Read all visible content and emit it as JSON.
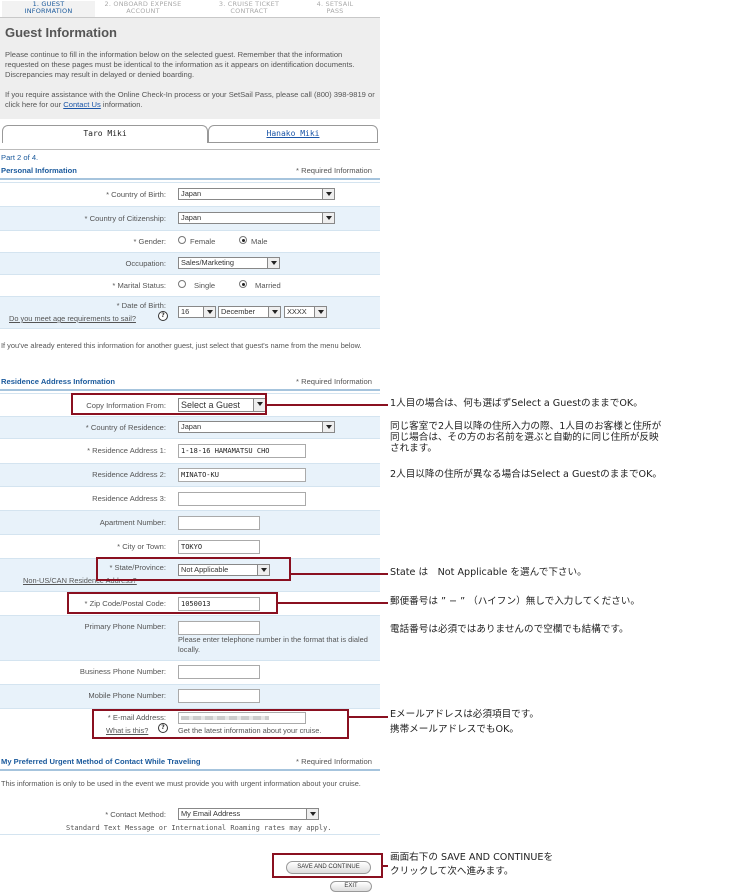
{
  "steps": [
    {
      "num": "1. GUEST",
      "name": "INFORMATION"
    },
    {
      "num": "2. ONBOARD EXPENSE",
      "name": "ACCOUNT"
    },
    {
      "num": "3. CRUISE TICKET",
      "name": "CONTRACT"
    },
    {
      "num": "4. SETSAIL",
      "name": "PASS"
    }
  ],
  "page": {
    "title": "Guest Information",
    "intro1": "Please continue to fill in the information below on the selected guest. Remember that the information requested on these pages must be identical to the information as it appears on identification documents. Discrepancies may result in delayed or denied boarding.",
    "intro2_a": "If you require assistance with the Online Check-In process or your SetSail Pass, please call (800) 398-9819 or click here for our ",
    "intro2_link": "Contact Us",
    "intro2_b": " information."
  },
  "tabs": {
    "guest1": "Taro Miki",
    "guest2": "Hanako Miki"
  },
  "personal": {
    "part": "Part 2 of 4.",
    "heading": "Personal Information",
    "required": "* Required Information",
    "country_birth_label": "* Country of Birth:",
    "country_birth_value": "Japan",
    "country_citizen_label": "* Country of Citizenship:",
    "country_citizen_value": "Japan",
    "gender_label": "* Gender:",
    "gender_female": "Female",
    "gender_male": "Male",
    "occupation_label": "Occupation:",
    "occupation_value": "Sales/Marketing",
    "marital_label": "* Marital Status:",
    "marital_single": "Single",
    "marital_married": "Married",
    "dob_label": "* Date of Birth:",
    "age_link": "Do you meet age requirements to sail?",
    "dob_day": "16",
    "dob_month": "December",
    "dob_year": "XXXX"
  },
  "already_note": "If you've already entered this information for another guest, just select that guest's name from the menu below.",
  "residence": {
    "heading": "Residence Address Information",
    "required": "* Required Information",
    "copy_label": "Copy Information From:",
    "copy_value": "Select a Guest",
    "country_label": "* Country of Residence:",
    "country_value": "Japan",
    "addr1_label": "* Residence Address 1:",
    "addr1_value": "1-18-16 HAMAMATSU CHO",
    "addr2_label": "Residence Address 2:",
    "addr2_value": "MINATO-KU",
    "addr3_label": "Residence Address 3:",
    "apt_label": "Apartment Number:",
    "city_label": "* City or Town:",
    "city_value": "TOKYO",
    "state_label": "* State/Province:",
    "state_link": "Non-US/CAN Residence Address?",
    "state_value": "Not Applicable",
    "zip_label": "* Zip Code/Postal Code:",
    "zip_value": "1050013",
    "primary_label": "Primary Phone Number:",
    "primary_hint": "Please enter telephone number in the format that is dialed locally.",
    "business_label": "Business Phone Number:",
    "mobile_label": "Mobile Phone Number:",
    "email_label": "* E-mail Address:",
    "email_link": "What is this?",
    "email_hint": "Get the latest information about your cruise."
  },
  "urgent": {
    "heading": "My Preferred Urgent Method of Contact While Traveling",
    "required": "* Required Information",
    "note": "This information is only to be used in the event we must provide you with urgent information about your cruise.",
    "method_label": "* Contact Method:",
    "method_value": "My Email Address",
    "rates": "Standard Text Message or International Roaming rates may apply."
  },
  "buttons": {
    "save": "SAVE AND CONTINUE",
    "exit": "EXIT"
  },
  "annotations": {
    "copy1": "1人目の場合は、何も選ばずSelect a GuestのままでOK。",
    "copy2": "同じ客室で2人目以降の住所入力の際、1人目のお客様と住所が",
    "copy3": "同じ場合は、その方のお名前を選ぶと自動的に同じ住所が反映",
    "copy4": "されます。",
    "copy5": "2人目以降の住所が異なる場合はSelect a GuestのままでOK。",
    "state": "State は　Not Applicable を選んで下さい。",
    "zip": "郵便番号は ” − ” （ハイフン）無しで入力してください。",
    "phone": "電話番号は必須ではありませんので空欄でも結構です。",
    "email1": "Eメールアドレスは必須項目です。",
    "email2": "携帯メールアドレスでもOK。",
    "save1": "画面右下の SAVE AND CONTINUEを",
    "save2": "クリックして次へ進みます。"
  },
  "colors": {
    "accent": "#8a1020",
    "link": "#1a55a8",
    "section": "#1b5a9c"
  }
}
